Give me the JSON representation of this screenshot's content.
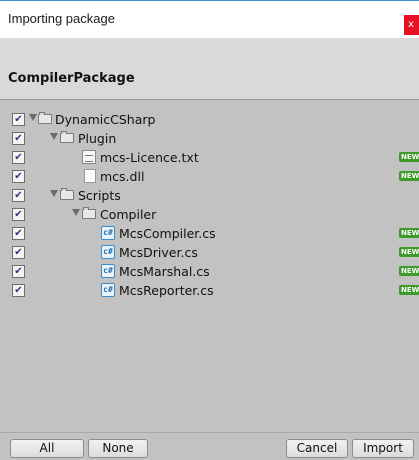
{
  "window": {
    "title": "Importing package",
    "close_label": "x",
    "package_name": "CompilerPackage"
  },
  "tree": [
    {
      "label": "DynamicCSharp",
      "type": "folder",
      "checked": true,
      "expanded": true,
      "is_new": false
    },
    {
      "label": "Plugin",
      "type": "folder",
      "checked": true,
      "expanded": true,
      "is_new": false
    },
    {
      "label": "mcs-Licence.txt",
      "type": "text-file",
      "checked": true,
      "is_new": true
    },
    {
      "label": "mcs.dll",
      "type": "dll-file",
      "checked": true,
      "is_new": true
    },
    {
      "label": "Scripts",
      "type": "folder",
      "checked": true,
      "expanded": true,
      "is_new": false
    },
    {
      "label": "Compiler",
      "type": "folder",
      "checked": true,
      "expanded": true,
      "is_new": false
    },
    {
      "label": "McsCompiler.cs",
      "type": "cs-file",
      "checked": true,
      "is_new": true
    },
    {
      "label": "McsDriver.cs",
      "type": "cs-file",
      "checked": true,
      "is_new": true
    },
    {
      "label": "McsMarshal.cs",
      "type": "cs-file",
      "checked": true,
      "is_new": true
    },
    {
      "label": "McsReporter.cs",
      "type": "cs-file",
      "checked": true,
      "is_new": true
    }
  ],
  "badge_text": "NEW",
  "checkmark": "✔",
  "cs_icon_glyph": "c#",
  "buttons": {
    "all": "All",
    "none": "None",
    "cancel": "Cancel",
    "import": "Import"
  },
  "colors": {
    "new_badge": "#3f9a2c",
    "close_button": "#e81123",
    "title_accent": "#3c8fd9"
  }
}
